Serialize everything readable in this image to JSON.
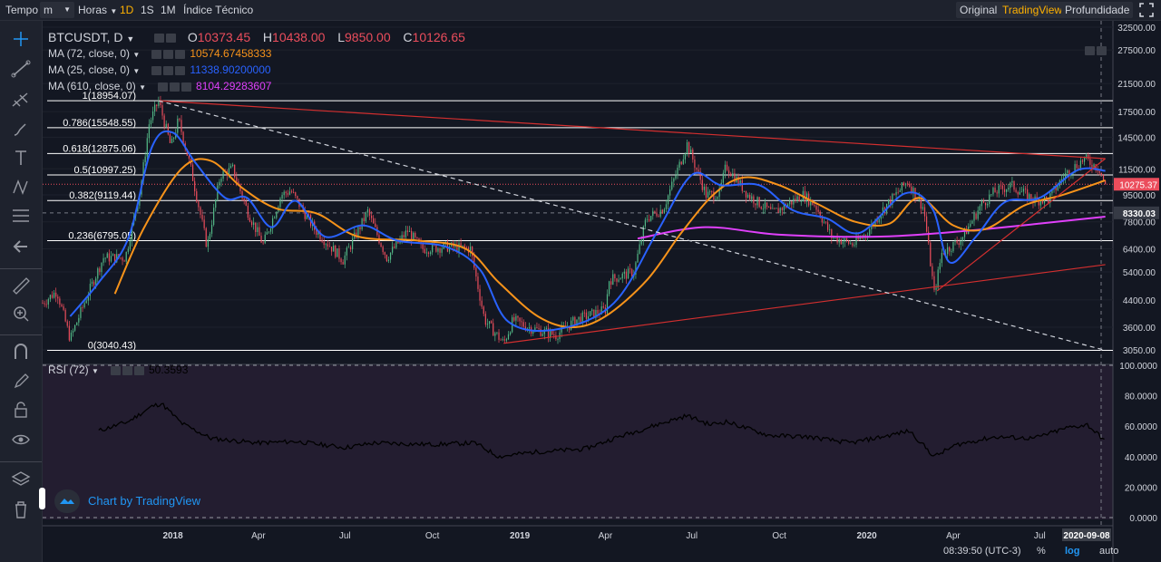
{
  "toolbar_top": {
    "tempo_label": "Tempo",
    "interval_select": "m",
    "horas_label": "Horas",
    "intervals": [
      "1D",
      "1S",
      "1M"
    ],
    "active_interval": "1D",
    "indicators_label": "Índice Técnico",
    "views": [
      "Original",
      "TradingView",
      "Profundidade"
    ],
    "active_view": "TradingView"
  },
  "legend": {
    "symbol": "BTCUSDT, D",
    "ohlc": [
      {
        "k": "O",
        "v": "10373.45"
      },
      {
        "k": "H",
        "v": "10438.00"
      },
      {
        "k": "L",
        "v": "9850.00"
      },
      {
        "k": "C",
        "v": "10126.65"
      }
    ],
    "mas": [
      {
        "label": "MA (72, close, 0)",
        "value": "10574.67458333",
        "color": "#f7931a"
      },
      {
        "label": "MA (25, close, 0)",
        "value": "11338.90200000",
        "color": "#2962ff"
      },
      {
        "label": "MA (610, close, 0)",
        "value": "8104.29283607",
        "color": "#e040fb"
      }
    ],
    "rsi_label": "RSI (72)",
    "rsi_value": "50.3593"
  },
  "brand_label": "Chart by TradingView",
  "bottom": {
    "time": "08:39:50 (UTC-3)",
    "percent": "%",
    "log": "log",
    "auto": "auto"
  },
  "colors": {
    "background": "#131722",
    "rsi_pane": "#231d30",
    "candle_up": "#53b987",
    "candle_down": "#eb4d5c",
    "ma72": "#f7931a",
    "ma25": "#2962ff",
    "ma610": "#e040fb",
    "trendline": "#d32f2f",
    "fib": "#ffffff",
    "rsi_line": "#000000"
  },
  "chart_data": [
    {
      "type": "line",
      "series_kind": "candlestick with moving averages (log scale)",
      "x_ticks": [
        "2018",
        "Apr",
        "Jul",
        "Oct",
        "2019",
        "Apr",
        "Jul",
        "Oct",
        "2020",
        "Apr",
        "Jul"
      ],
      "x_cursor_label": "2020-09-08",
      "y_scale": "log",
      "y_ticks": [
        "32500.00",
        "27500.00",
        "21500.00",
        "17500.00",
        "14500.00",
        "11500.00",
        "9500.00",
        "7800.00",
        "6400.00",
        "5400.00",
        "4400.00",
        "3600.00",
        "3050.00"
      ],
      "last_price_label": "10275.37",
      "last_price": 10275.37,
      "crosshair_label": "8330.03",
      "crosshair_price": 8330.03,
      "ylim": [
        2950,
        33500
      ],
      "fib_levels": [
        {
          "label": "1(18954.07)",
          "value": 18954.07
        },
        {
          "label": "0.786(15548.55)",
          "value": 15548.55
        },
        {
          "label": "0.618(12875.06)",
          "value": 12875.06
        },
        {
          "label": "0.5(10997.25)",
          "value": 10997.25
        },
        {
          "label": "0.382(9119.44)",
          "value": 9119.44
        },
        {
          "label": "0.236(6795.05)",
          "value": 6795.05
        },
        {
          "label": "0(3040.43)",
          "value": 3040.43
        }
      ],
      "price_path": [
        [
          "2017-08-17",
          4300
        ],
        [
          "2017-09-01",
          4700
        ],
        [
          "2017-09-15",
          3300
        ],
        [
          "2017-10-01",
          4400
        ],
        [
          "2017-10-20",
          6000
        ],
        [
          "2017-11-12",
          6000
        ],
        [
          "2017-11-28",
          10000
        ],
        [
          "2017-12-07",
          16000
        ],
        [
          "2017-12-17",
          18954
        ],
        [
          "2017-12-30",
          13500
        ],
        [
          "2018-01-07",
          16500
        ],
        [
          "2018-01-20",
          11500
        ],
        [
          "2018-02-06",
          6500
        ],
        [
          "2018-02-20",
          11000
        ],
        [
          "2018-03-05",
          11500
        ],
        [
          "2018-03-20",
          8500
        ],
        [
          "2018-04-06",
          6600
        ],
        [
          "2018-04-25",
          9500
        ],
        [
          "2018-05-05",
          9800
        ],
        [
          "2018-05-30",
          7400
        ],
        [
          "2018-06-29",
          5900
        ],
        [
          "2018-07-25",
          8400
        ],
        [
          "2018-08-14",
          6000
        ],
        [
          "2018-09-05",
          7300
        ],
        [
          "2018-09-20",
          6400
        ],
        [
          "2018-10-15",
          6500
        ],
        [
          "2018-11-10",
          6400
        ],
        [
          "2018-11-25",
          3800
        ],
        [
          "2018-12-15",
          3200
        ],
        [
          "2018-12-25",
          3800
        ],
        [
          "2019-01-10",
          3600
        ],
        [
          "2019-02-08",
          3400
        ],
        [
          "2019-03-01",
          3800
        ],
        [
          "2019-04-01",
          4100
        ],
        [
          "2019-04-05",
          5100
        ],
        [
          "2019-05-01",
          5400
        ],
        [
          "2019-05-14",
          8000
        ],
        [
          "2019-06-01",
          8600
        ],
        [
          "2019-06-26",
          13800
        ],
        [
          "2019-07-16",
          9500
        ],
        [
          "2019-07-30",
          9600
        ],
        [
          "2019-08-06",
          11800
        ],
        [
          "2019-08-29",
          9500
        ],
        [
          "2019-09-24",
          8300
        ],
        [
          "2019-10-26",
          9500
        ],
        [
          "2019-11-08",
          8800
        ],
        [
          "2019-11-25",
          7000
        ],
        [
          "2019-12-18",
          6600
        ],
        [
          "2020-01-01",
          7200
        ],
        [
          "2020-01-20",
          8700
        ],
        [
          "2020-02-13",
          10500
        ],
        [
          "2020-03-01",
          8600
        ],
        [
          "2020-03-12",
          4600
        ],
        [
          "2020-03-20",
          6200
        ],
        [
          "2020-04-10",
          6900
        ],
        [
          "2020-04-30",
          8800
        ],
        [
          "2020-05-14",
          9700
        ],
        [
          "2020-06-01",
          10200
        ],
        [
          "2020-06-25",
          9150
        ],
        [
          "2020-07-10",
          9200
        ],
        [
          "2020-07-27",
          11000
        ],
        [
          "2020-08-17",
          12400
        ],
        [
          "2020-09-02",
          11500
        ],
        [
          "2020-09-08",
          10126
        ]
      ],
      "ma72_path": [
        [
          "2017-11-01",
          4600
        ],
        [
          "2017-12-01",
          7400
        ],
        [
          "2018-01-10",
          11500
        ],
        [
          "2018-02-10",
          12200
        ],
        [
          "2018-03-15",
          10000
        ],
        [
          "2018-04-20",
          8600
        ],
        [
          "2018-06-01",
          8300
        ],
        [
          "2018-07-15",
          7000
        ],
        [
          "2018-09-15",
          6800
        ],
        [
          "2018-11-05",
          6400
        ],
        [
          "2018-12-10",
          5000
        ],
        [
          "2019-01-20",
          3900
        ],
        [
          "2019-02-25",
          3600
        ],
        [
          "2019-04-01",
          3900
        ],
        [
          "2019-05-15",
          5100
        ],
        [
          "2019-06-20",
          7200
        ],
        [
          "2019-07-25",
          9600
        ],
        [
          "2019-08-25",
          10800
        ],
        [
          "2019-10-01",
          10200
        ],
        [
          "2019-11-10",
          8900
        ],
        [
          "2019-12-20",
          7800
        ],
        [
          "2020-01-25",
          7700
        ],
        [
          "2020-02-25",
          9300
        ],
        [
          "2020-04-01",
          7600
        ],
        [
          "2020-05-05",
          7400
        ],
        [
          "2020-06-15",
          8800
        ],
        [
          "2020-07-25",
          9500
        ],
        [
          "2020-09-08",
          10574
        ]
      ],
      "ma25_path": [
        [
          "2017-09-15",
          3900
        ],
        [
          "2017-10-15",
          5000
        ],
        [
          "2017-11-15",
          6900
        ],
        [
          "2017-12-10",
          13500
        ],
        [
          "2018-01-01",
          15000
        ],
        [
          "2018-01-25",
          12000
        ],
        [
          "2018-02-25",
          9300
        ],
        [
          "2018-03-20",
          9300
        ],
        [
          "2018-04-15",
          7500
        ],
        [
          "2018-05-10",
          9100
        ],
        [
          "2018-06-10",
          7000
        ],
        [
          "2018-07-20",
          7600
        ],
        [
          "2018-08-25",
          6800
        ],
        [
          "2018-10-15",
          6500
        ],
        [
          "2018-11-20",
          5500
        ],
        [
          "2018-12-20",
          3750
        ],
        [
          "2019-02-10",
          3550
        ],
        [
          "2019-04-10",
          4300
        ],
        [
          "2019-05-25",
          7200
        ],
        [
          "2019-07-01",
          11000
        ],
        [
          "2019-08-01",
          10200
        ],
        [
          "2019-09-10",
          10200
        ],
        [
          "2019-10-15",
          8500
        ],
        [
          "2019-11-20",
          8000
        ],
        [
          "2019-12-25",
          7200
        ],
        [
          "2020-02-10",
          9600
        ],
        [
          "2020-03-10",
          8600
        ],
        [
          "2020-03-28",
          5800
        ],
        [
          "2020-04-25",
          7000
        ],
        [
          "2020-05-25",
          9000
        ],
        [
          "2020-07-01",
          9300
        ],
        [
          "2020-08-10",
          11400
        ],
        [
          "2020-09-08",
          11338
        ]
      ],
      "ma610_path": [
        [
          "2019-05-05",
          6900
        ],
        [
          "2019-07-15",
          7500
        ],
        [
          "2019-10-01",
          7100
        ],
        [
          "2020-01-15",
          7000
        ],
        [
          "2020-04-15",
          7300
        ],
        [
          "2020-07-01",
          7700
        ],
        [
          "2020-09-08",
          8104
        ]
      ],
      "trendlines": [
        {
          "kind": "resistance",
          "style": "solid",
          "from": [
            "2017-12-17",
            18954
          ],
          "to": [
            "2020-09-08",
            12400
          ]
        },
        {
          "kind": "support",
          "style": "solid",
          "from": [
            "2018-12-15",
            3200
          ],
          "to": [
            "2020-09-08",
            5700
          ]
        },
        {
          "kind": "support",
          "style": "solid",
          "from": [
            "2020-03-15",
            4700
          ],
          "to": [
            "2020-09-08",
            12400
          ]
        },
        {
          "kind": "diagonal",
          "style": "dashed",
          "from": [
            "2017-12-17",
            18954
          ],
          "to": [
            "2020-09-08",
            3040
          ]
        }
      ]
    },
    {
      "type": "line",
      "name": "RSI (72)",
      "y_ticks": [
        "100.0000",
        "80.0000",
        "60.0000",
        "40.0000",
        "20.0000",
        "0.0000"
      ],
      "ylim": [
        0,
        100
      ],
      "rsi_path": [
        [
          "2017-10-15",
          57
        ],
        [
          "2017-11-15",
          63
        ],
        [
          "2017-12-10",
          73
        ],
        [
          "2017-12-20",
          75
        ],
        [
          "2018-01-10",
          62
        ],
        [
          "2018-02-10",
          52
        ],
        [
          "2018-04-01",
          49
        ],
        [
          "2018-05-10",
          50
        ],
        [
          "2018-07-01",
          46
        ],
        [
          "2018-08-01",
          49
        ],
        [
          "2018-10-01",
          48
        ],
        [
          "2018-11-15",
          49
        ],
        [
          "2018-12-10",
          40
        ],
        [
          "2019-01-15",
          43
        ],
        [
          "2019-03-10",
          45
        ],
        [
          "2019-04-10",
          52
        ],
        [
          "2019-05-20",
          60
        ],
        [
          "2019-06-26",
          67
        ],
        [
          "2019-07-20",
          61
        ],
        [
          "2019-08-06",
          63
        ],
        [
          "2019-09-20",
          54
        ],
        [
          "2019-11-01",
          53
        ],
        [
          "2019-12-15",
          49
        ],
        [
          "2020-01-25",
          54
        ],
        [
          "2020-02-15",
          57
        ],
        [
          "2020-03-12",
          40
        ],
        [
          "2020-04-05",
          48
        ],
        [
          "2020-05-15",
          53
        ],
        [
          "2020-06-25",
          52
        ],
        [
          "2020-07-30",
          59
        ],
        [
          "2020-08-20",
          61
        ],
        [
          "2020-09-08",
          50.36
        ]
      ]
    }
  ]
}
